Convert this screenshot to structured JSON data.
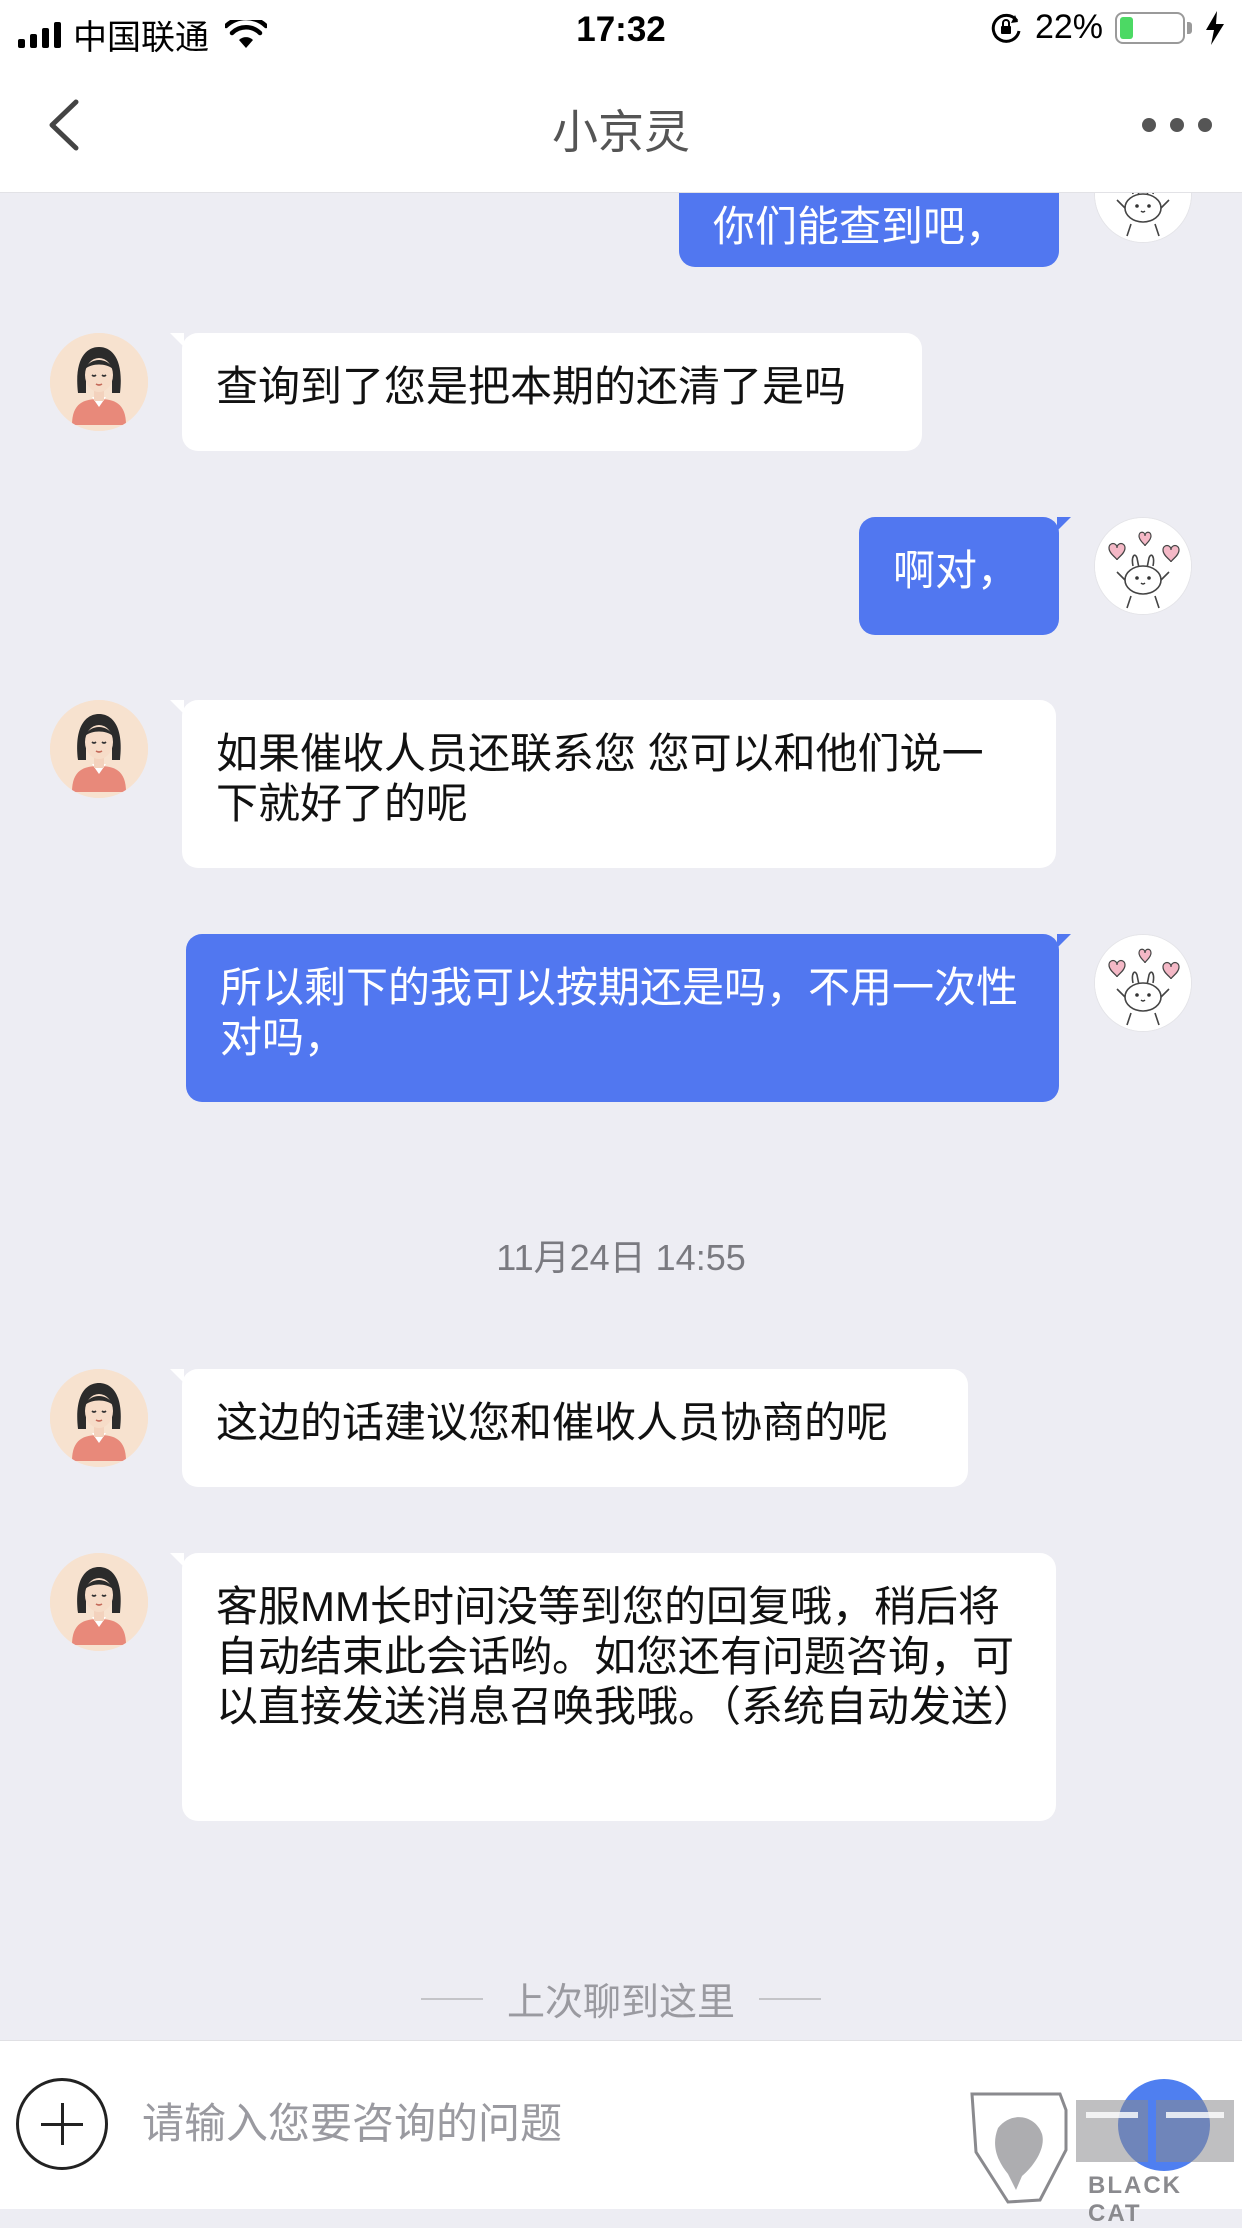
{
  "status_bar": {
    "carrier": "中国联通",
    "time": "17:32",
    "battery_percent": "22%",
    "battery_level": 0.22,
    "battery_color": "#4cd964"
  },
  "nav": {
    "title": "小京灵",
    "back_icon": "chevron-left-icon",
    "more_icon": "more-dots-icon"
  },
  "messages": [
    {
      "sender": "user",
      "text": "你们能查到吧，"
    },
    {
      "sender": "agent",
      "text": "查询到了您是把本期的还清了是吗"
    },
    {
      "sender": "user",
      "text": "啊对，"
    },
    {
      "sender": "agent",
      "text": "如果催收人员还联系您 您可以和他们说一下就好了的呢"
    },
    {
      "sender": "user",
      "text": "所以剩下的我可以按期还是吗，不用一次性对吗，"
    },
    {
      "sender": "agent",
      "text": "这边的话建议您和催收人员协商的呢"
    },
    {
      "sender": "agent",
      "text": "客服MM长时间没等到您的回复哦，稍后将自动结束此会话哟。如您还有问题咨询，可以直接发送消息召唤我哦。（系统自动发送）"
    }
  ],
  "timestamp": "11月24日 14:55",
  "divider_text": "上次聊到这里",
  "input": {
    "placeholder": "请输入您要咨询的问题",
    "value": ""
  },
  "watermark_text": "BLACK CAT",
  "colors": {
    "user_bubble": "#5177f0",
    "agent_bubble": "#ffffff",
    "background": "#ededf3"
  }
}
